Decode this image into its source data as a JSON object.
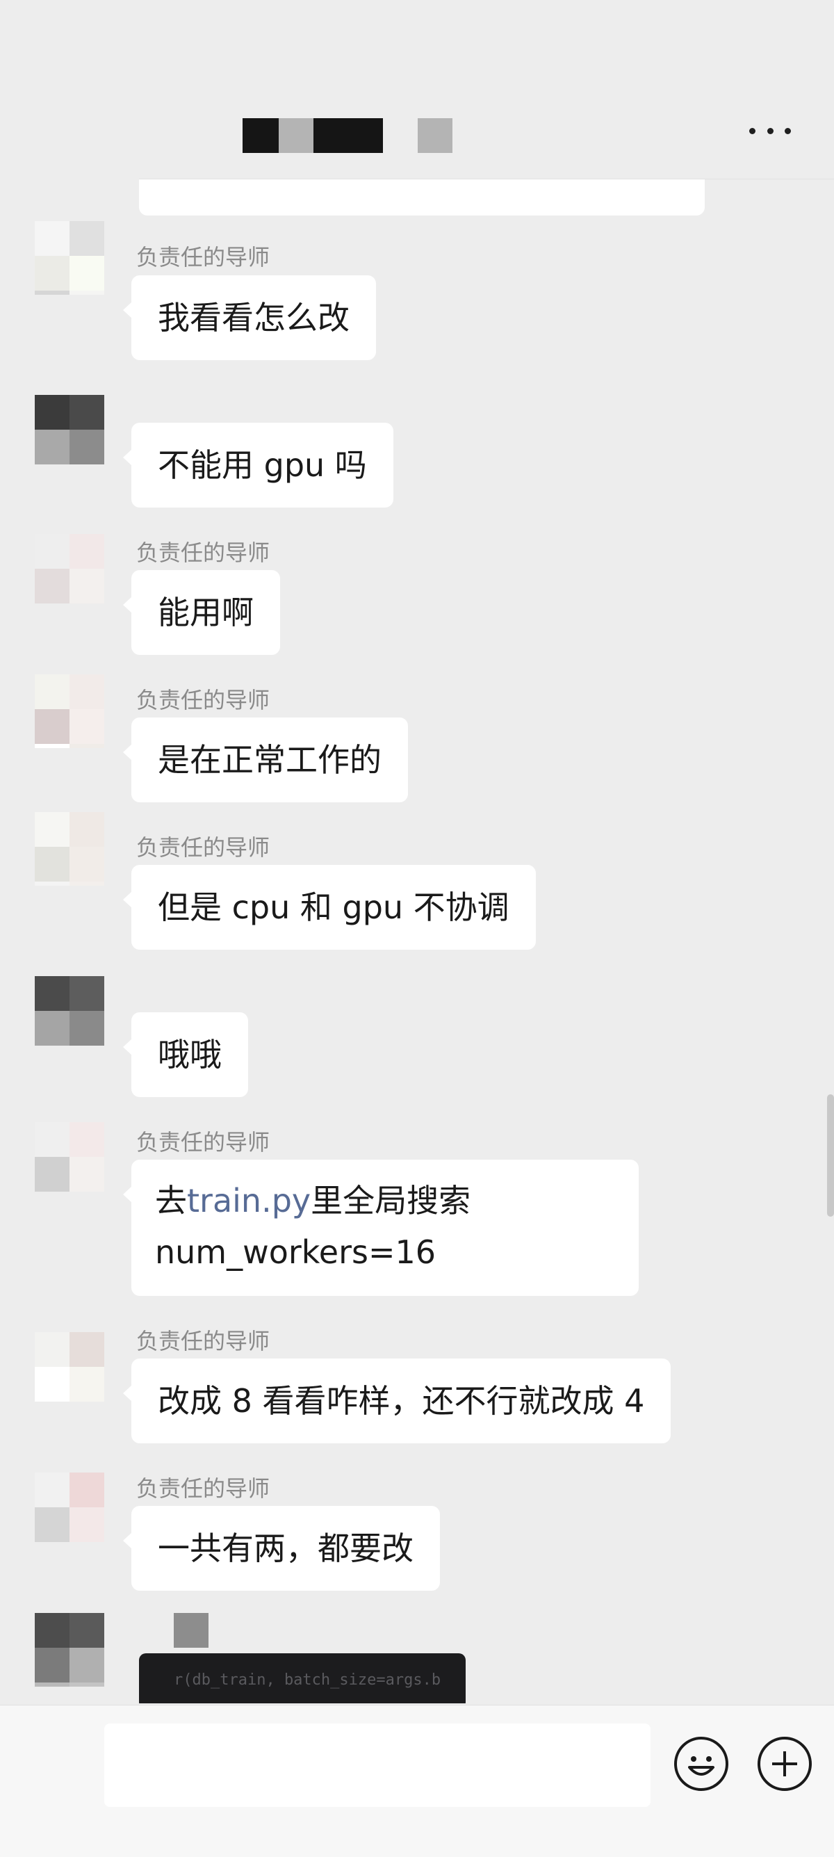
{
  "chat": {
    "sender_name": "负责任的导师"
  },
  "messages": [
    {
      "side": "left",
      "sender": "负责任的导师",
      "text": "我看看怎么改"
    },
    {
      "side": "left",
      "sender": "",
      "text": "不能用 gpu 吗"
    },
    {
      "side": "left",
      "sender": "负责任的导师",
      "text": "能用啊"
    },
    {
      "side": "left",
      "sender": "负责任的导师",
      "text": "是在正常工作的"
    },
    {
      "side": "left",
      "sender": "负责任的导师",
      "text": "但是 cpu 和 gpu 不协调"
    },
    {
      "side": "left",
      "sender": "",
      "text": "哦哦"
    },
    {
      "side": "left",
      "sender": "负责任的导师",
      "text_pre": "去",
      "link": "train.py",
      "text_post": "里全局搜索  num_workers=16"
    },
    {
      "side": "left",
      "sender": "负责任的导师",
      "text": "改成 8 看看咋样，还不行就改成 4"
    },
    {
      "side": "left",
      "sender": "负责任的导师",
      "text": "一共有两，都要改"
    }
  ],
  "image_message": {
    "code_text": "r(db_train, batch_size=args.b"
  },
  "input": {
    "value": ""
  },
  "icons": {
    "more": "more-dots-icon",
    "emoji": "emoji-smile-icon",
    "add": "plus-circle-icon"
  },
  "colors": {
    "background": "#ededed",
    "bubble": "#ffffff",
    "link": "#576b95"
  }
}
